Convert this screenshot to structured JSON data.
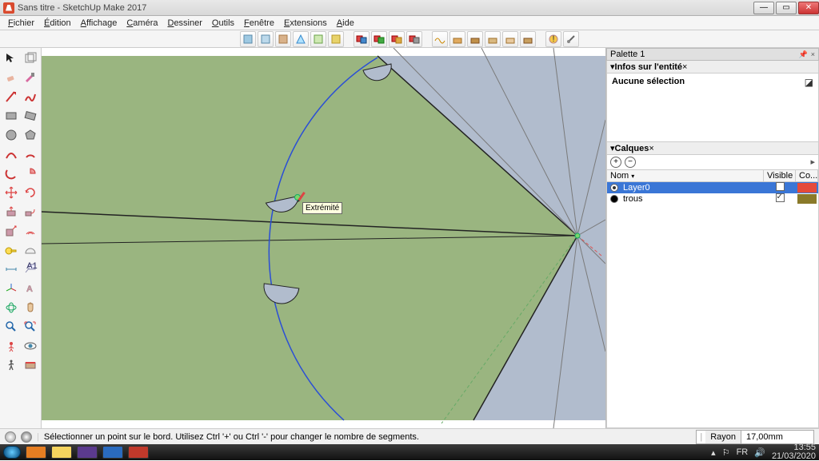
{
  "titlebar": {
    "title": "Sans titre - SketchUp Make 2017"
  },
  "menu": [
    "Fichier",
    "Édition",
    "Affichage",
    "Caméra",
    "Dessiner",
    "Outils",
    "Fenêtre",
    "Extensions",
    "Aide"
  ],
  "panels": {
    "tray_title": "Palette 1",
    "entity": {
      "header": "Infos sur l'entité",
      "body": "Aucune sélection"
    },
    "layers": {
      "header": "Calques",
      "columns": {
        "name": "Nom",
        "visible": "Visible",
        "color": "Co..."
      },
      "rows": [
        {
          "name": "Layer0",
          "visible": false,
          "selected": true,
          "radio": true,
          "color": "#e54a3a"
        },
        {
          "name": "trous",
          "visible": true,
          "selected": false,
          "radio": false,
          "color": "#8a7a2a"
        }
      ]
    }
  },
  "status": {
    "hint": "Sélectionner un point sur le bord. Utilisez Ctrl '+' ou Ctrl '-' pour changer le nombre de segments.",
    "measure_label": "Rayon",
    "measure_value": "17,00mm"
  },
  "inference_tip": "Extrémité",
  "tray": {
    "lang": "FR",
    "time": "13:55",
    "date": "21/03/2020"
  }
}
